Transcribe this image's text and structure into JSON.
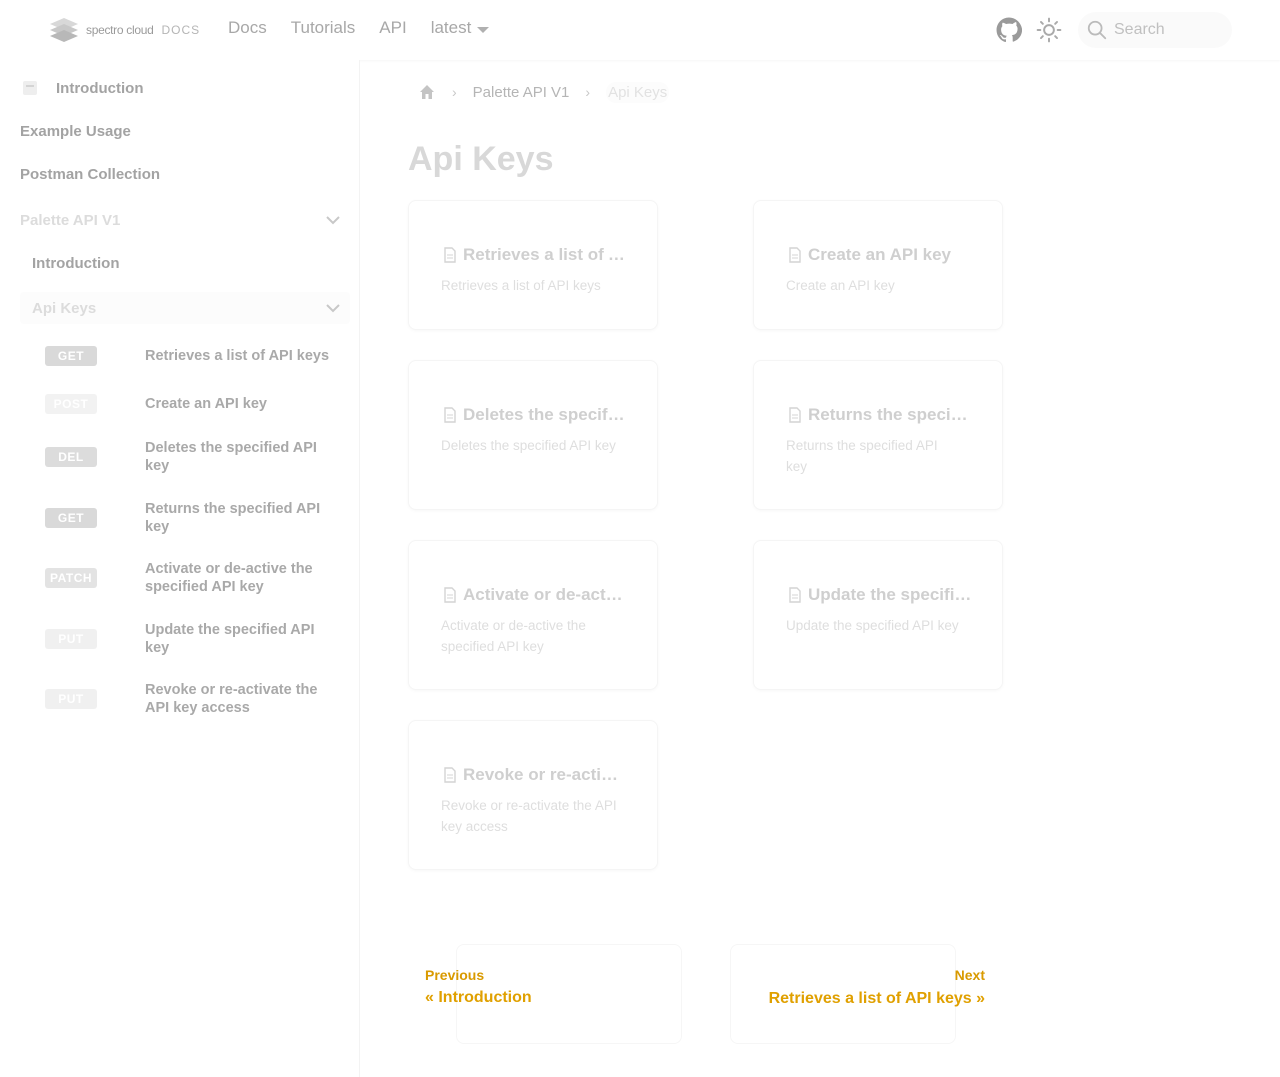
{
  "brand": {
    "name": "spectro cloud",
    "suffix": "DOCS"
  },
  "nav": {
    "docs": "Docs",
    "tutorials": "Tutorials",
    "api": "API",
    "version": "latest"
  },
  "search": {
    "placeholder": "Search"
  },
  "sidebar": {
    "introduction": "Introduction",
    "example_usage": "Example Usage",
    "postman": "Postman Collection",
    "palette_group": "Palette API V1",
    "palette_intro": "Introduction",
    "api_keys_group": "Api Keys",
    "endpoints": [
      {
        "method": "GET",
        "label": "Retrieves a list of API keys"
      },
      {
        "method": "POST",
        "label": "Create an API key"
      },
      {
        "method": "DEL",
        "label": "Deletes the specified API key"
      },
      {
        "method": "GET",
        "label": "Returns the specified API key"
      },
      {
        "method": "PATCH",
        "label": "Activate or de-active the specified API key"
      },
      {
        "method": "PUT",
        "label": "Update the specified API key"
      },
      {
        "method": "PUT",
        "label": "Revoke or re-activate the API key access"
      }
    ]
  },
  "breadcrumb": {
    "parent": "Palette API V1",
    "current": "Api Keys"
  },
  "page_title": "Api Keys",
  "cards": [
    {
      "title": "Retrieves a list of API keys",
      "desc": "Retrieves a list of API keys"
    },
    {
      "title": "Create an API key",
      "desc": "Create an API key"
    },
    {
      "title": "Deletes the specified API key",
      "desc": "Deletes the specified API key"
    },
    {
      "title": "Returns the specified API key",
      "desc": "Returns the specified API key"
    },
    {
      "title": "Activate or de-active the specified API key",
      "desc": "Activate or de-active the specified API key"
    },
    {
      "title": "Update the specified API key",
      "desc": "Update the specified API key"
    },
    {
      "title": "Revoke or re-activate the API key access",
      "desc": "Revoke or re-activate the API key access"
    }
  ],
  "pagination": {
    "prev_sub": "Previous",
    "prev_main": "« Introduction",
    "next_sub": "Next",
    "next_main": "Retrieves a list of API keys »"
  },
  "colors": {
    "badge_get": "#d9d9d9",
    "badge_post": "#f2f2f2",
    "badge_del": "#dcdcdc",
    "badge_patch": "#e3e3e3",
    "badge_put": "#f0f0f0",
    "pager_text": "#e0a000"
  }
}
